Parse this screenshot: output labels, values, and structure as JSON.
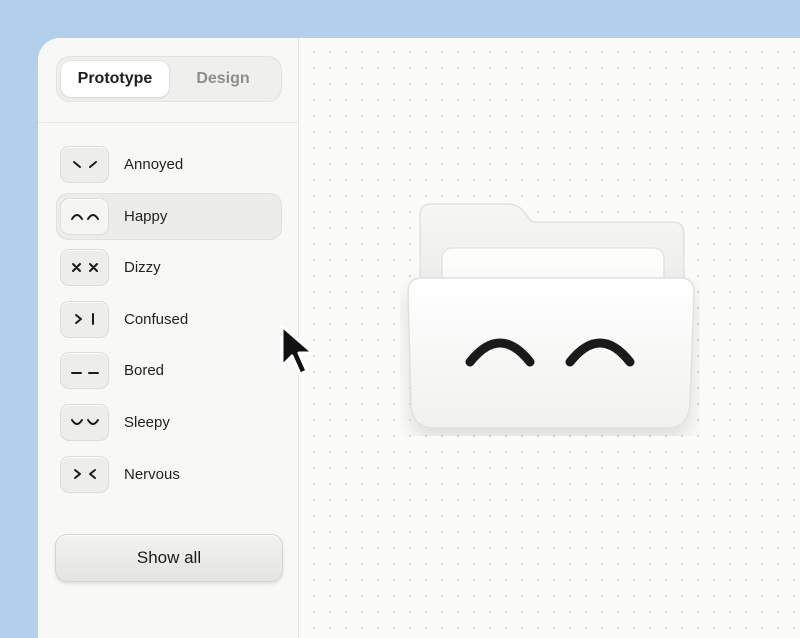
{
  "segmented": {
    "tabs": [
      {
        "label": "Prototype",
        "active": true
      },
      {
        "label": "Design",
        "active": false
      }
    ]
  },
  "emotions": [
    {
      "label": "Annoyed",
      "icon": "annoyed-face-icon",
      "selected": false
    },
    {
      "label": "Happy",
      "icon": "happy-face-icon",
      "selected": true
    },
    {
      "label": "Dizzy",
      "icon": "dizzy-face-icon",
      "selected": false
    },
    {
      "label": "Confused",
      "icon": "confused-face-icon",
      "selected": false
    },
    {
      "label": "Bored",
      "icon": "bored-face-icon",
      "selected": false
    },
    {
      "label": "Sleepy",
      "icon": "sleepy-face-icon",
      "selected": false
    },
    {
      "label": "Nervous",
      "icon": "nervous-face-icon",
      "selected": false
    }
  ],
  "show_all_label": "Show all",
  "preview": {
    "expression": "Happy",
    "icon": "folder-character-icon"
  },
  "colors": {
    "background": "#b2d0ec",
    "panel": "#fbfbfa",
    "ink": "#1a1a1a"
  }
}
